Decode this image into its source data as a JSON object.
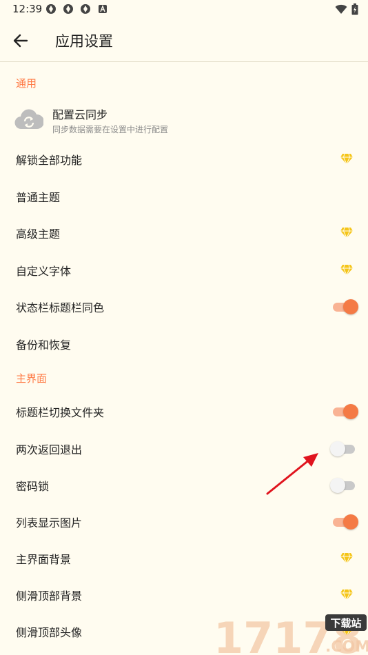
{
  "status": {
    "time": "12:39"
  },
  "header": {
    "title": "应用设置"
  },
  "sections": {
    "general": "通用",
    "main": "主界面"
  },
  "cloud_sync": {
    "title": "配置云同步",
    "subtitle": "同步数据需要在设置中进行配置"
  },
  "general_items": [
    {
      "label": "解锁全部功能",
      "control": "diamond-icon"
    },
    {
      "label": "普通主题",
      "control": "none"
    },
    {
      "label": "高级主题",
      "control": "diamond-icon"
    },
    {
      "label": "自定义字体",
      "control": "diamond-icon"
    },
    {
      "label": "状态栏标题栏同色",
      "control": "toggle",
      "on": true
    },
    {
      "label": "备份和恢复",
      "control": "none"
    }
  ],
  "main_items": [
    {
      "label": "标题栏切换文件夹",
      "control": "toggle",
      "on": true
    },
    {
      "label": "两次返回退出",
      "control": "toggle",
      "on": false
    },
    {
      "label": "密码锁",
      "control": "toggle",
      "on": false
    },
    {
      "label": "列表显示图片",
      "control": "toggle",
      "on": true
    },
    {
      "label": "主界面背景",
      "control": "diamond-icon"
    },
    {
      "label": "侧滑顶部背景",
      "control": "diamond-icon"
    },
    {
      "label": "侧滑顶部头像",
      "control": "diamond-icon"
    }
  ],
  "watermark": {
    "number": "17178",
    "badge": "下载站",
    "domain": ".COM"
  },
  "colors": {
    "accent": "#ff7a45",
    "background": "#fffcf0",
    "diamond": "#f5c518"
  }
}
